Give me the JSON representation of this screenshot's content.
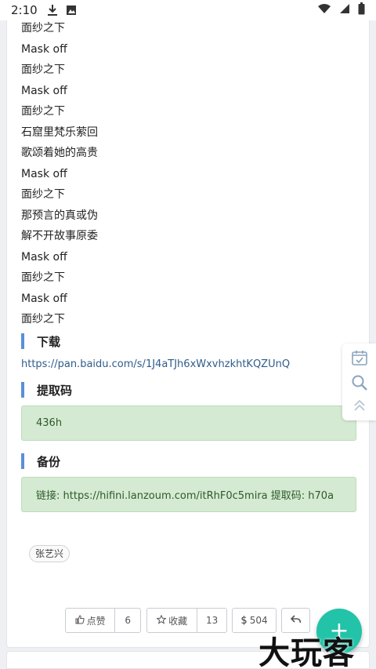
{
  "status_bar": {
    "time": "2:10"
  },
  "lyrics": [
    "面纱之下",
    "Mask off",
    "面纱之下",
    "Mask off",
    "面纱之下",
    "石窟里梵乐萦回",
    "歌颂着她的高贵",
    "Mask off",
    "面纱之下",
    "那预言的真或伪",
    "解不开故事原委",
    "Mask off",
    "面纱之下",
    "Mask off",
    "面纱之下"
  ],
  "sections": {
    "download_title": "下载",
    "download_link": "https://pan.baidu.com/s/1J4aTJh6xWxvhzkhtKQZUnQ",
    "code_title": "提取码",
    "code_value": "436h",
    "backup_title": "备份",
    "backup_text": "链接: https://hifini.lanzoum.com/itRhF0c5mira 提取码: h70a"
  },
  "tag": "张艺兴",
  "actions": {
    "like_label": "点赞",
    "like_count": "6",
    "fav_label": "收藏",
    "fav_count": "13",
    "coin_label": "504"
  },
  "fab_symbol": "+",
  "watermark": "大玩客",
  "colors": {
    "accent_bar": "#5b8fd6",
    "link": "#2f5c8a",
    "notice_bg": "#d5ead3",
    "notice_text": "#2d5a2a",
    "fab": "#22c3a8"
  },
  "icons": {
    "status": [
      "download-icon",
      "image-icon",
      "wifi-icon",
      "signal-icon",
      "battery-icon"
    ],
    "side": [
      "calendar-check-icon",
      "search-icon",
      "chevron-up-icon"
    ],
    "actions": [
      "thumbs-up-icon",
      "star-icon",
      "reply-icon"
    ]
  }
}
